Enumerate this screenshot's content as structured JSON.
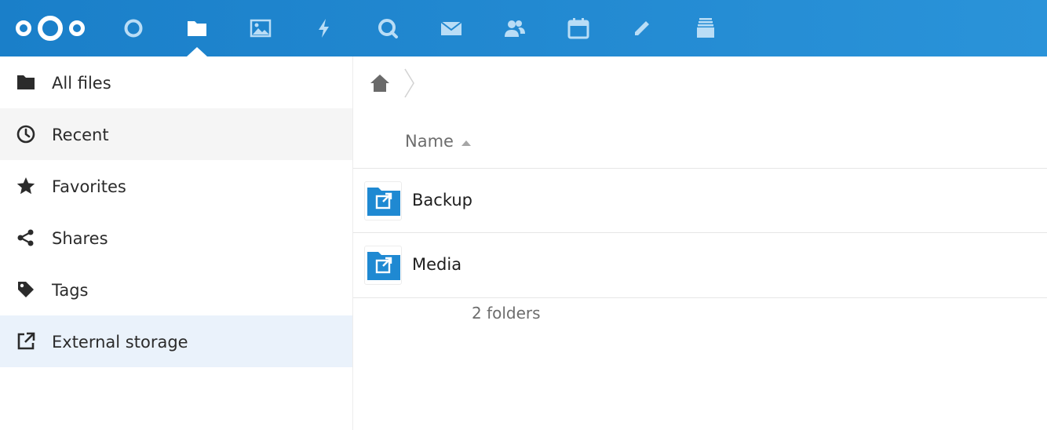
{
  "header": {
    "logo_icon": "nextcloud-logo-icon",
    "apps": [
      {
        "name": "dashboard",
        "icon": "circle-icon",
        "active": false
      },
      {
        "name": "files",
        "icon": "folder-icon",
        "active": true
      },
      {
        "name": "photos",
        "icon": "image-icon",
        "active": false
      },
      {
        "name": "activity",
        "icon": "lightning-icon",
        "active": false
      },
      {
        "name": "talk",
        "icon": "search-bubble-icon",
        "active": false
      },
      {
        "name": "mail",
        "icon": "envelope-icon",
        "active": false
      },
      {
        "name": "contacts",
        "icon": "users-icon",
        "active": false
      },
      {
        "name": "calendar",
        "icon": "calendar-icon",
        "active": false
      },
      {
        "name": "notes",
        "icon": "pencil-icon",
        "active": false
      },
      {
        "name": "deck",
        "icon": "stack-icon",
        "active": false
      }
    ],
    "bar_color": "#1f89d2"
  },
  "sidebar": {
    "items": [
      {
        "label": "All files",
        "icon": "folder-icon",
        "state": "normal"
      },
      {
        "label": "Recent",
        "icon": "clock-icon",
        "state": "hover"
      },
      {
        "label": "Favorites",
        "icon": "star-icon",
        "state": "normal"
      },
      {
        "label": "Shares",
        "icon": "share-icon",
        "state": "normal"
      },
      {
        "label": "Tags",
        "icon": "tag-icon",
        "state": "normal"
      },
      {
        "label": "External storage",
        "icon": "external-link-icon",
        "state": "selected"
      }
    ]
  },
  "main": {
    "breadcrumb": {
      "home_icon": "home-icon"
    },
    "columns": {
      "name": "Name",
      "sort": "ascending"
    },
    "files": [
      {
        "name": "Backup",
        "icon": "external-folder-icon"
      },
      {
        "name": "Media",
        "icon": "external-folder-icon"
      }
    ],
    "summary": "2 folders",
    "folder_color": "#1f89d2"
  }
}
